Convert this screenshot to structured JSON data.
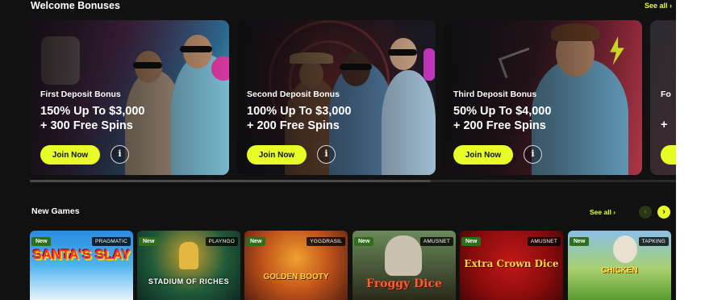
{
  "welcome": {
    "title": "Welcome Bonuses",
    "see_all": "See all ›",
    "cards": [
      {
        "tag": "First Deposit Bonus",
        "offer_line1": "150% Up To $3,000",
        "offer_line2": "+ 300 Free Spins",
        "join": "Join Now",
        "info": "i"
      },
      {
        "tag": "Second Deposit Bonus",
        "offer_line1": "100% Up To $3,000",
        "offer_line2": "+ 200 Free Spins",
        "join": "Join Now",
        "info": "i"
      },
      {
        "tag": "Third Deposit Bonus",
        "offer_line1": "50% Up To $4,000",
        "offer_line2": "+ 200 Free Spins",
        "join": "Join Now",
        "info": "i"
      },
      {
        "tag": "Fo",
        "offer_line1": "",
        "offer_line2": "+",
        "join": "",
        "info": ""
      }
    ]
  },
  "new_games": {
    "title": "New Games",
    "see_all": "See all ›",
    "prev": "‹",
    "next": "›",
    "games": [
      {
        "badge": "New",
        "provider": "PRAGMATIC",
        "title": "SANTA'S SLAY"
      },
      {
        "badge": "New",
        "provider": "PLAYNGO",
        "title": "STADIUM OF RICHES"
      },
      {
        "badge": "New",
        "provider": "YGGDRASIL",
        "title": "GOLDEN BOOTY"
      },
      {
        "badge": "New",
        "provider": "AMUSNET",
        "title": "Froggy Dice"
      },
      {
        "badge": "New",
        "provider": "AMUSNET",
        "title": "Extra Crown Dice"
      },
      {
        "badge": "New",
        "provider": "TAPKING",
        "title": "CHICKEN"
      }
    ]
  },
  "colors": {
    "background": "#111111",
    "accent": "#e8ff27",
    "new_badge": "#2f6e1a"
  }
}
